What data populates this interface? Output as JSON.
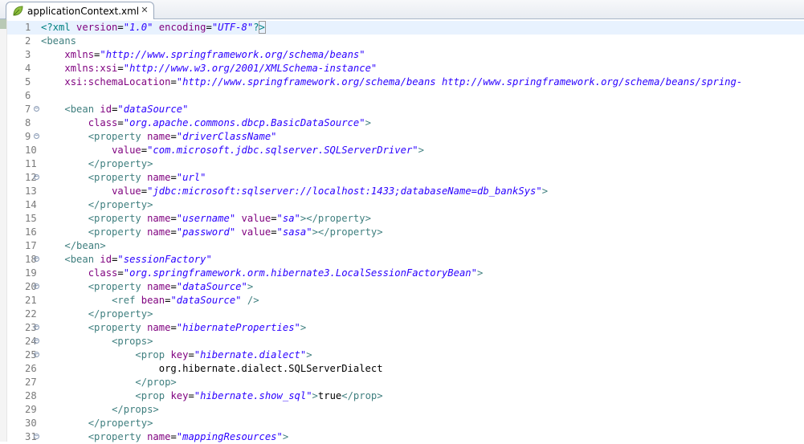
{
  "tab": {
    "title": "applicationContext.xml",
    "close_glyph": "✕",
    "icon": "xml-leaf-icon"
  },
  "colors": {
    "tag": "#3f7f7f",
    "attr": "#7f007f",
    "value": "#2a00ff",
    "text": "#000000",
    "current_line": "#e8f2fe"
  },
  "editor": {
    "lines": [
      {
        "num": "1",
        "fold": false,
        "current": true,
        "tokens": [
          [
            "proc",
            "<?xml "
          ],
          [
            "attr",
            "version"
          ],
          [
            "txt",
            "="
          ],
          [
            "val",
            "\"1.0\""
          ],
          [
            "txt",
            " "
          ],
          [
            "attr",
            "encoding"
          ],
          [
            "txt",
            "="
          ],
          [
            "val",
            "\"UTF-8\""
          ],
          [
            "proc",
            "?"
          ],
          [
            "proc",
            ">"
          ]
        ]
      },
      {
        "num": "2",
        "fold": false,
        "tokens": [
          [
            "tag",
            "<beans"
          ]
        ]
      },
      {
        "num": "3",
        "fold": false,
        "tokens": [
          [
            "txt",
            "    "
          ],
          [
            "attr",
            "xmlns"
          ],
          [
            "txt",
            "="
          ],
          [
            "val",
            "\"http://www.springframework.org/schema/beans\""
          ]
        ]
      },
      {
        "num": "4",
        "fold": false,
        "tokens": [
          [
            "txt",
            "    "
          ],
          [
            "attr",
            "xmlns:xsi"
          ],
          [
            "txt",
            "="
          ],
          [
            "val",
            "\"http://www.w3.org/2001/XMLSchema-instance\""
          ]
        ]
      },
      {
        "num": "5",
        "fold": false,
        "tokens": [
          [
            "txt",
            "    "
          ],
          [
            "attr",
            "xsi:schemaLocation"
          ],
          [
            "txt",
            "="
          ],
          [
            "val",
            "\"http://www.springframework.org/schema/beans http://www.springframework.org/schema/beans/spring-"
          ]
        ]
      },
      {
        "num": "6",
        "fold": false,
        "tokens": []
      },
      {
        "num": "7",
        "fold": true,
        "tokens": [
          [
            "txt",
            "    "
          ],
          [
            "tag",
            "<bean "
          ],
          [
            "attr",
            "id"
          ],
          [
            "txt",
            "="
          ],
          [
            "val",
            "\"dataSource\""
          ]
        ]
      },
      {
        "num": "8",
        "fold": false,
        "tokens": [
          [
            "txt",
            "        "
          ],
          [
            "attr",
            "class"
          ],
          [
            "txt",
            "="
          ],
          [
            "val",
            "\"org.apache.commons.dbcp.BasicDataSource\""
          ],
          [
            "tag",
            ">"
          ]
        ]
      },
      {
        "num": "9",
        "fold": true,
        "tokens": [
          [
            "txt",
            "        "
          ],
          [
            "tag",
            "<property "
          ],
          [
            "attr",
            "name"
          ],
          [
            "txt",
            "="
          ],
          [
            "val",
            "\"driverClassName\""
          ]
        ]
      },
      {
        "num": "10",
        "fold": false,
        "tokens": [
          [
            "txt",
            "            "
          ],
          [
            "attr",
            "value"
          ],
          [
            "txt",
            "="
          ],
          [
            "val",
            "\"com.microsoft.jdbc.sqlserver.SQLServerDriver\""
          ],
          [
            "tag",
            ">"
          ]
        ]
      },
      {
        "num": "11",
        "fold": false,
        "tokens": [
          [
            "txt",
            "        "
          ],
          [
            "tag",
            "</property>"
          ]
        ]
      },
      {
        "num": "12",
        "fold": true,
        "tokens": [
          [
            "txt",
            "        "
          ],
          [
            "tag",
            "<property "
          ],
          [
            "attr",
            "name"
          ],
          [
            "txt",
            "="
          ],
          [
            "val",
            "\"url\""
          ]
        ]
      },
      {
        "num": "13",
        "fold": false,
        "tokens": [
          [
            "txt",
            "            "
          ],
          [
            "attr",
            "value"
          ],
          [
            "txt",
            "="
          ],
          [
            "val",
            "\"jdbc:microsoft:sqlserver://localhost:1433;databaseName=db_bankSys\""
          ],
          [
            "tag",
            ">"
          ]
        ]
      },
      {
        "num": "14",
        "fold": false,
        "tokens": [
          [
            "txt",
            "        "
          ],
          [
            "tag",
            "</property>"
          ]
        ]
      },
      {
        "num": "15",
        "fold": false,
        "tokens": [
          [
            "txt",
            "        "
          ],
          [
            "tag",
            "<property "
          ],
          [
            "attr",
            "name"
          ],
          [
            "txt",
            "="
          ],
          [
            "val",
            "\"username\""
          ],
          [
            "txt",
            " "
          ],
          [
            "attr",
            "value"
          ],
          [
            "txt",
            "="
          ],
          [
            "val",
            "\"sa\""
          ],
          [
            "tag",
            "></property>"
          ]
        ]
      },
      {
        "num": "16",
        "fold": false,
        "tokens": [
          [
            "txt",
            "        "
          ],
          [
            "tag",
            "<property "
          ],
          [
            "attr",
            "name"
          ],
          [
            "txt",
            "="
          ],
          [
            "val",
            "\"password\""
          ],
          [
            "txt",
            " "
          ],
          [
            "attr",
            "value"
          ],
          [
            "txt",
            "="
          ],
          [
            "val",
            "\"sasa\""
          ],
          [
            "tag",
            "></property>"
          ]
        ]
      },
      {
        "num": "17",
        "fold": false,
        "tokens": [
          [
            "txt",
            "    "
          ],
          [
            "tag",
            "</bean>"
          ]
        ]
      },
      {
        "num": "18",
        "fold": true,
        "tokens": [
          [
            "txt",
            "    "
          ],
          [
            "tag",
            "<bean "
          ],
          [
            "attr",
            "id"
          ],
          [
            "txt",
            "="
          ],
          [
            "val",
            "\"sessionFactory\""
          ]
        ]
      },
      {
        "num": "19",
        "fold": false,
        "tokens": [
          [
            "txt",
            "        "
          ],
          [
            "attr",
            "class"
          ],
          [
            "txt",
            "="
          ],
          [
            "val",
            "\"org.springframework.orm.hibernate3.LocalSessionFactoryBean\""
          ],
          [
            "tag",
            ">"
          ]
        ]
      },
      {
        "num": "20",
        "fold": true,
        "tokens": [
          [
            "txt",
            "        "
          ],
          [
            "tag",
            "<property "
          ],
          [
            "attr",
            "name"
          ],
          [
            "txt",
            "="
          ],
          [
            "val",
            "\"dataSource\""
          ],
          [
            "tag",
            ">"
          ]
        ]
      },
      {
        "num": "21",
        "fold": false,
        "tokens": [
          [
            "txt",
            "            "
          ],
          [
            "tag",
            "<ref "
          ],
          [
            "attr",
            "bean"
          ],
          [
            "txt",
            "="
          ],
          [
            "val",
            "\"dataSource\""
          ],
          [
            "txt",
            " "
          ],
          [
            "tag",
            "/>"
          ]
        ]
      },
      {
        "num": "22",
        "fold": false,
        "tokens": [
          [
            "txt",
            "        "
          ],
          [
            "tag",
            "</property>"
          ]
        ]
      },
      {
        "num": "23",
        "fold": true,
        "tokens": [
          [
            "txt",
            "        "
          ],
          [
            "tag",
            "<property "
          ],
          [
            "attr",
            "name"
          ],
          [
            "txt",
            "="
          ],
          [
            "val",
            "\"hibernateProperties\""
          ],
          [
            "tag",
            ">"
          ]
        ]
      },
      {
        "num": "24",
        "fold": true,
        "tokens": [
          [
            "txt",
            "            "
          ],
          [
            "tag",
            "<props>"
          ]
        ]
      },
      {
        "num": "25",
        "fold": true,
        "tokens": [
          [
            "txt",
            "                "
          ],
          [
            "tag",
            "<prop "
          ],
          [
            "attr",
            "key"
          ],
          [
            "txt",
            "="
          ],
          [
            "val",
            "\"hibernate.dialect\""
          ],
          [
            "tag",
            ">"
          ]
        ]
      },
      {
        "num": "26",
        "fold": false,
        "tokens": [
          [
            "txt",
            "                    org.hibernate.dialect.SQLServerDialect"
          ]
        ]
      },
      {
        "num": "27",
        "fold": false,
        "tokens": [
          [
            "txt",
            "                "
          ],
          [
            "tag",
            "</prop>"
          ]
        ]
      },
      {
        "num": "28",
        "fold": false,
        "tokens": [
          [
            "txt",
            "                "
          ],
          [
            "tag",
            "<prop "
          ],
          [
            "attr",
            "key"
          ],
          [
            "txt",
            "="
          ],
          [
            "val",
            "\"hibernate.show_sql\""
          ],
          [
            "tag",
            ">"
          ],
          [
            "txt",
            "true"
          ],
          [
            "tag",
            "</prop>"
          ]
        ]
      },
      {
        "num": "29",
        "fold": false,
        "tokens": [
          [
            "txt",
            "            "
          ],
          [
            "tag",
            "</props>"
          ]
        ]
      },
      {
        "num": "30",
        "fold": false,
        "tokens": [
          [
            "txt",
            "        "
          ],
          [
            "tag",
            "</property>"
          ]
        ]
      },
      {
        "num": "31",
        "fold": true,
        "tokens": [
          [
            "txt",
            "        "
          ],
          [
            "tag",
            "<property "
          ],
          [
            "attr",
            "name"
          ],
          [
            "txt",
            "="
          ],
          [
            "val",
            "\"mappingResources\""
          ],
          [
            "tag",
            ">"
          ]
        ]
      }
    ]
  }
}
